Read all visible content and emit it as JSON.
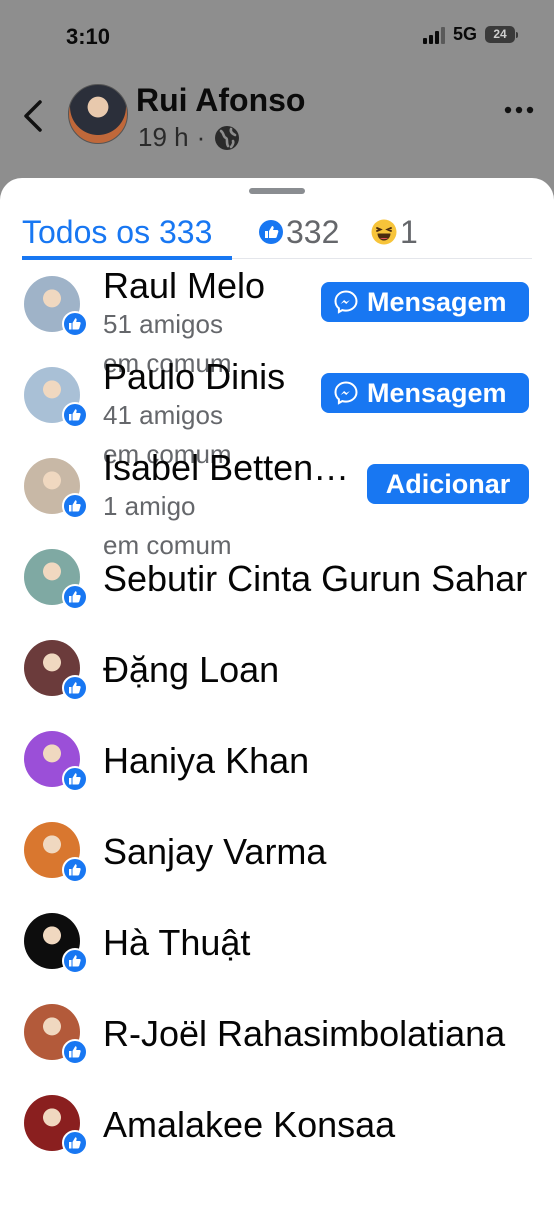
{
  "status_bar": {
    "time": "3:10",
    "network": "5G",
    "battery": "24"
  },
  "header": {
    "name": "Rui Afonso",
    "time": "19 h",
    "separator": "·",
    "back_icon": "chevron-left-icon",
    "privacy_icon": "globe-icon",
    "more_icon": "more-horizontal-icon"
  },
  "tabs": {
    "all_label": "Todos os 333",
    "like_count": "332",
    "haha_count": "1"
  },
  "people": [
    {
      "name": "Raul Melo",
      "sub": "51 amigos",
      "sub2": "em comum",
      "button": "Mensagem",
      "button_type": "message",
      "avatar_bg": "#9fb3c8"
    },
    {
      "name": "Paulo Dinis",
      "sub": "41 amigos",
      "sub2": "em comum",
      "button": "Mensagem",
      "button_type": "message",
      "avatar_bg": "#a9c0d6"
    },
    {
      "name": "Isabel Betten…",
      "sub": "1 amigo",
      "sub2": "em comum",
      "button": "Adicionar",
      "button_type": "add",
      "avatar_bg": "#c8b8a6"
    },
    {
      "name": "Sebutir Cinta Gurun Sahar",
      "avatar_bg": "#7fa9a3"
    },
    {
      "name": "Đặng Loan",
      "avatar_bg": "#6b3b3b"
    },
    {
      "name": "Haniya Khan",
      "avatar_bg": "#9b4fd8"
    },
    {
      "name": "Sanjay Varma",
      "avatar_bg": "#d9772f"
    },
    {
      "name": "Hà Thuật",
      "avatar_bg": "#0d0d0d"
    },
    {
      "name": "R-Joël Rahasimbolatiana",
      "avatar_bg": "#b35a3a"
    },
    {
      "name": "Amalakee Konsaa",
      "avatar_bg": "#8a1f1f"
    }
  ],
  "colors": {
    "accent": "#1877f2",
    "secondary_text": "#65676b"
  }
}
